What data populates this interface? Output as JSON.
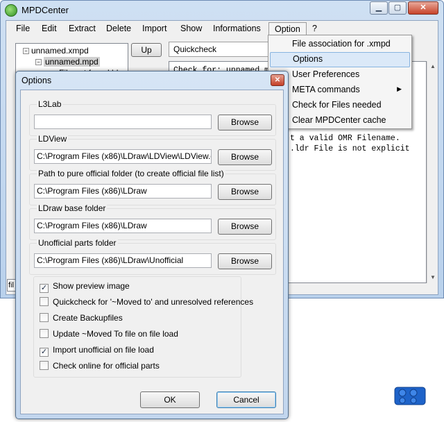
{
  "window": {
    "title": "MPDCenter",
    "min_glyph": "▁",
    "max_glyph": "▢",
    "close_glyph": "✕"
  },
  "menubar": {
    "items": [
      "File",
      "Edit",
      "Extract",
      "Delete",
      "Import",
      "Show",
      "Informations",
      "Option",
      "?"
    ],
    "active": "Option"
  },
  "tree": {
    "items": [
      {
        "label": "unnamed.xmpd",
        "toggle": "−"
      },
      {
        "label": "unnamed.mpd",
        "toggle": "−"
      },
      {
        "label": "File not found.ldr"
      }
    ]
  },
  "toolbar": {
    "up_label": "Up"
  },
  "quickcheck": {
    "tab_label": "Quickcheck",
    "lines": [
      "Check for: unnamed.m",
      "t a valid OMR Filename.",
      ".ldr File is not explicit"
    ]
  },
  "status_stub": "fil",
  "option_menu": {
    "items": [
      {
        "label": "File association for .xmpd"
      },
      {
        "label": "Options",
        "highlighted": true
      },
      {
        "label": "User Preferences"
      },
      {
        "label": "META commands",
        "submenu": true
      },
      {
        "label": "Check for Files needed"
      },
      {
        "label": "Clear MPDCenter cache"
      }
    ],
    "submenu_arrow": "▶"
  },
  "options_dialog": {
    "title": "Options",
    "close_glyph": "✕",
    "groups": [
      {
        "label": "L3Lab",
        "value": "",
        "button": "Browse"
      },
      {
        "label": "LDView",
        "value": "C:\\Program Files (x86)\\LDraw\\LDView\\LDView.exe",
        "button": "Browse"
      },
      {
        "label": "Path to pure official folder (to create official file list)",
        "value": "C:\\Program Files (x86)\\LDraw",
        "button": "Browse"
      },
      {
        "label": "LDraw base folder",
        "value": "C:\\Program Files (x86)\\LDraw",
        "button": "Browse"
      },
      {
        "label": "Unofficial parts folder",
        "value": "C:\\Program Files (x86)\\LDraw\\Unofficial",
        "button": "Browse"
      }
    ],
    "checkboxes": [
      {
        "label": "Show preview image",
        "checked": true
      },
      {
        "label": "Quickcheck for '~Moved to' and unresolved references",
        "checked": false
      },
      {
        "label": "Create Backupfiles",
        "checked": false
      },
      {
        "label": "Update ~Moved To file on file load",
        "checked": false
      },
      {
        "label": "Import unofficial on file load",
        "checked": true
      },
      {
        "label": "Check online for official parts",
        "checked": false
      }
    ],
    "ok_label": "OK",
    "cancel_label": "Cancel",
    "check_glyph": "✓"
  },
  "colors": {
    "highlight": "#dbe9f8",
    "lego_brick": "#1e63c9"
  }
}
